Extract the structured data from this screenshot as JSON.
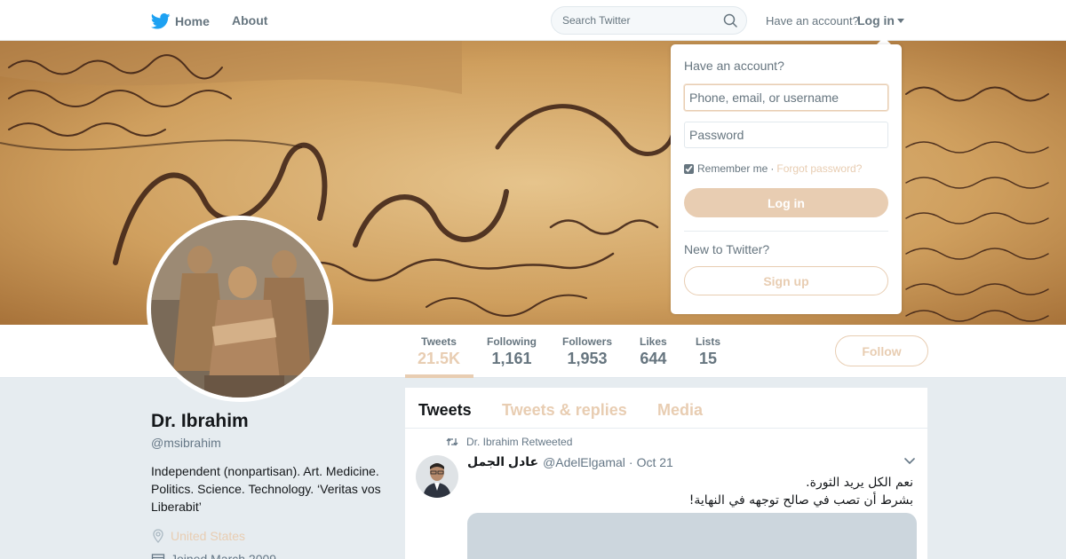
{
  "colors": {
    "accent": "#e8cdb2",
    "text_primary": "#14171a",
    "text_secondary": "#66757f",
    "background": "#e6ecf0",
    "brand_bird": "#1da1f2"
  },
  "topnav": {
    "home_label": "Home",
    "about_label": "About",
    "search_placeholder": "Search Twitter",
    "have_account": "Have an account?",
    "login_label": "Log in"
  },
  "profile_nav": {
    "stats": [
      {
        "label": "Tweets",
        "value": "21.5K"
      },
      {
        "label": "Following",
        "value": "1,161"
      },
      {
        "label": "Followers",
        "value": "1,953"
      },
      {
        "label": "Likes",
        "value": "644"
      },
      {
        "label": "Lists",
        "value": "15"
      }
    ],
    "follow_label": "Follow"
  },
  "profile": {
    "name": "Dr. Ibrahim",
    "handle": "@msibrahim",
    "bio": "Independent (nonpartisan). Art. Medicine. Politics. Science. Technology. ‘Veritas vos Liberabit’",
    "location": "United States",
    "joined": "Joined March 2009"
  },
  "timeline": {
    "tabs": [
      {
        "label": "Tweets"
      },
      {
        "label": "Tweets & replies"
      },
      {
        "label": "Media"
      }
    ],
    "tweet": {
      "retweet_context": "Dr. Ibrahim Retweeted",
      "fullname": "عادل الجمل",
      "username": "@AdelElgamal",
      "separator": "·",
      "date": "Oct 21",
      "text_line1": "نعم الكل يريد الثورة.",
      "text_line2": "بشرط أن تصب في صالح توجهه في النهاية!"
    }
  },
  "login_dropdown": {
    "title": "Have an account?",
    "username_placeholder": "Phone, email, or username",
    "password_placeholder": "Password",
    "remember_label": "Remember me",
    "separator": "·",
    "forgot_label": "Forgot password?",
    "login_button": "Log in",
    "new_prompt": "New to Twitter?",
    "signup_button": "Sign up"
  },
  "icons": {
    "brand": "twitter-bird-icon",
    "search": "search-icon",
    "caret": "caret-down-icon",
    "location": "location-pin-icon",
    "calendar": "calendar-icon",
    "retweet": "retweet-icon",
    "tweet_menu": "chevron-down-icon"
  }
}
